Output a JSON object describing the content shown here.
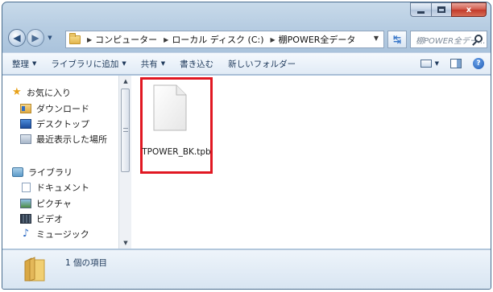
{
  "window": {
    "caption_buttons": {
      "close": "x"
    }
  },
  "address_bar": {
    "crumbs": [
      "コンピューター",
      "ローカル ディスク (C:)",
      "棚POWER全データ"
    ],
    "search_placeholder": "棚POWER全デー..."
  },
  "toolbar": {
    "organize": "整理",
    "add_to_library": "ライブラリに追加",
    "share": "共有",
    "burn": "書き込む",
    "new_folder": "新しいフォルダー"
  },
  "sidebar": {
    "favorites": "お気に入り",
    "favorite_items": [
      "ダウンロード",
      "デスクトップ",
      "最近表示した場所"
    ],
    "libraries": "ライブラリ",
    "library_items": [
      "ドキュメント",
      "ピクチャ",
      "ビデオ",
      "ミュージック"
    ]
  },
  "files": [
    {
      "name": "TPOWER_BK.tpb",
      "highlighted": true
    }
  ],
  "details": {
    "item_count": "1 個の項目"
  },
  "colors": {
    "highlight_border": "#e11822",
    "close_button": "#c23a2a"
  }
}
